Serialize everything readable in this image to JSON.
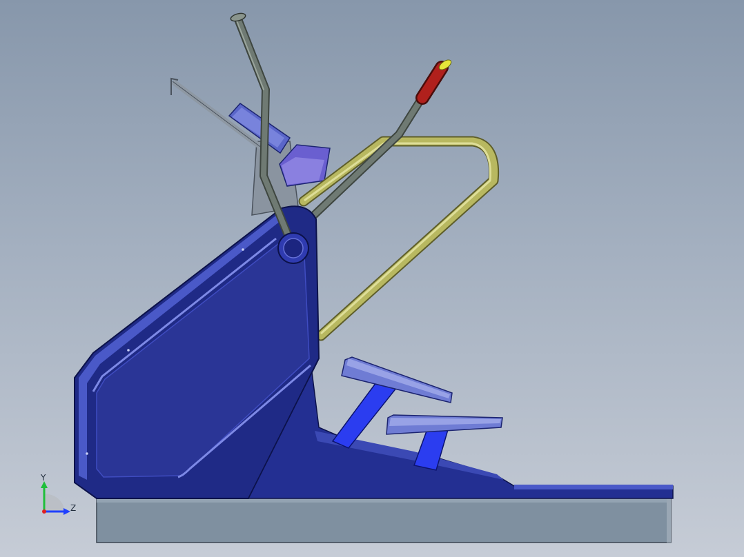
{
  "viewport": {
    "background_top": "#8797ab",
    "background_bottom": "#c6ccd6"
  },
  "model": {
    "description_icon": "stair-climber-machine-icon",
    "colors": {
      "body_blue": "#23308f",
      "body_blue_light": "#4a59c8",
      "rail_olive": "#b8b860",
      "lever_grey": "#6f7a73",
      "handle_red": "#b0201c",
      "handle_tip_yellow": "#e6e63a",
      "step_link_blue": "#2b3df0",
      "base_plate": "#7f90a0"
    }
  },
  "triad": {
    "y_label": "Y",
    "z_label": "Z",
    "y_color": "#1fbf3a",
    "z_color": "#2040ff",
    "x_color": "#e02020"
  }
}
